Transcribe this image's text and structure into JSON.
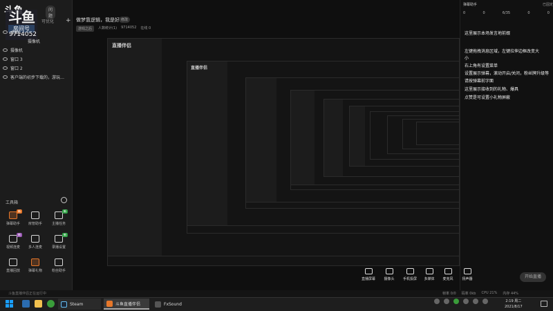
{
  "app": {
    "logo_text": "斗鱼",
    "logo_badge": "问题",
    "room_overlay_big": "斗鱼",
    "room_overlay_label": "房间号",
    "room_id": "9714052"
  },
  "scene": {
    "header": "可优化",
    "add": "+"
  },
  "sources": [
    {
      "label": "桌面1"
    },
    {
      "label": "摄像机"
    },
    {
      "label": "窗口 3"
    },
    {
      "label": "窗口 2"
    },
    {
      "label": "客户端的初步下载的，游玩…"
    }
  ],
  "toolbox": {
    "title": "工具箱",
    "tools": [
      {
        "label": "弹幕助手",
        "tag": "新",
        "tag_color": "#e6772a",
        "orange": true
      },
      {
        "label": "房管助手",
        "tag": "",
        "orange": false
      },
      {
        "label": "主播任务",
        "tag": "新",
        "tag_color": "#2ea043",
        "orange": false
      },
      {
        "label": "视频连麦",
        "tag": "新",
        "tag_color": "#9b59b6",
        "orange": false
      },
      {
        "label": "多人连麦",
        "tag": "",
        "orange": false
      },
      {
        "label": "录播设置",
        "tag": "新",
        "tag_color": "#2ea043",
        "orange": false
      },
      {
        "label": "直播回放",
        "tag": "",
        "orange": false
      },
      {
        "label": "弹幕礼物",
        "tag": "",
        "orange": true
      },
      {
        "label": "粉丝助手",
        "tag": "",
        "orange": false
      }
    ]
  },
  "stream": {
    "title": "做梦靠逻辑，我是好人",
    "badge": "修改",
    "meta": [
      "游戏之后",
      "人数统计(1)",
      "9714052",
      "在线 0"
    ]
  },
  "preview": {
    "logo_text": "直播伴侣"
  },
  "chat": {
    "header": "弹幕助手",
    "close": "已固定",
    "stats": [
      "0",
      "0",
      "6/35",
      "0",
      "0"
    ],
    "messages": [
      "这里展示本场发言地前缀",
      "左键拖拽消息区域，左键拉伸边框改变大",
      "小",
      "右上角有设置菜单",
      "设置展示弹幕，滚动开启/关闭，粉丝牌升级等",
      "请按弹幕前字面",
      "这里展示接收到的礼物、爆具",
      "点赞是可设置小礼物屏蔽"
    ]
  },
  "controls": [
    {
      "label": "直播屏幕"
    },
    {
      "label": "摄像头"
    },
    {
      "label": "手机投屏"
    },
    {
      "label": "多媒体"
    },
    {
      "label": "麦克风"
    },
    {
      "label": "扬声器"
    }
  ],
  "start_button": "开始直播",
  "status": {
    "left": "斗鱼直播伴侣正在运行中",
    "right": [
      "帧率 0/0",
      "码率 0kb",
      "CPU 21%",
      "内存 44%"
    ]
  },
  "taskbar": {
    "apps": [
      {
        "label": "Steam",
        "color": "#1b2838"
      },
      {
        "label": "斗鱼直播伴侣",
        "color": "#e6772a"
      },
      {
        "label": "FxSound",
        "color": "#333"
      }
    ],
    "time": "2:19 周二",
    "date": "2021/8/17"
  },
  "colors": {
    "accent": "#e6772a",
    "dark": "#0f0f0f",
    "panel": "#1c1c1c"
  }
}
